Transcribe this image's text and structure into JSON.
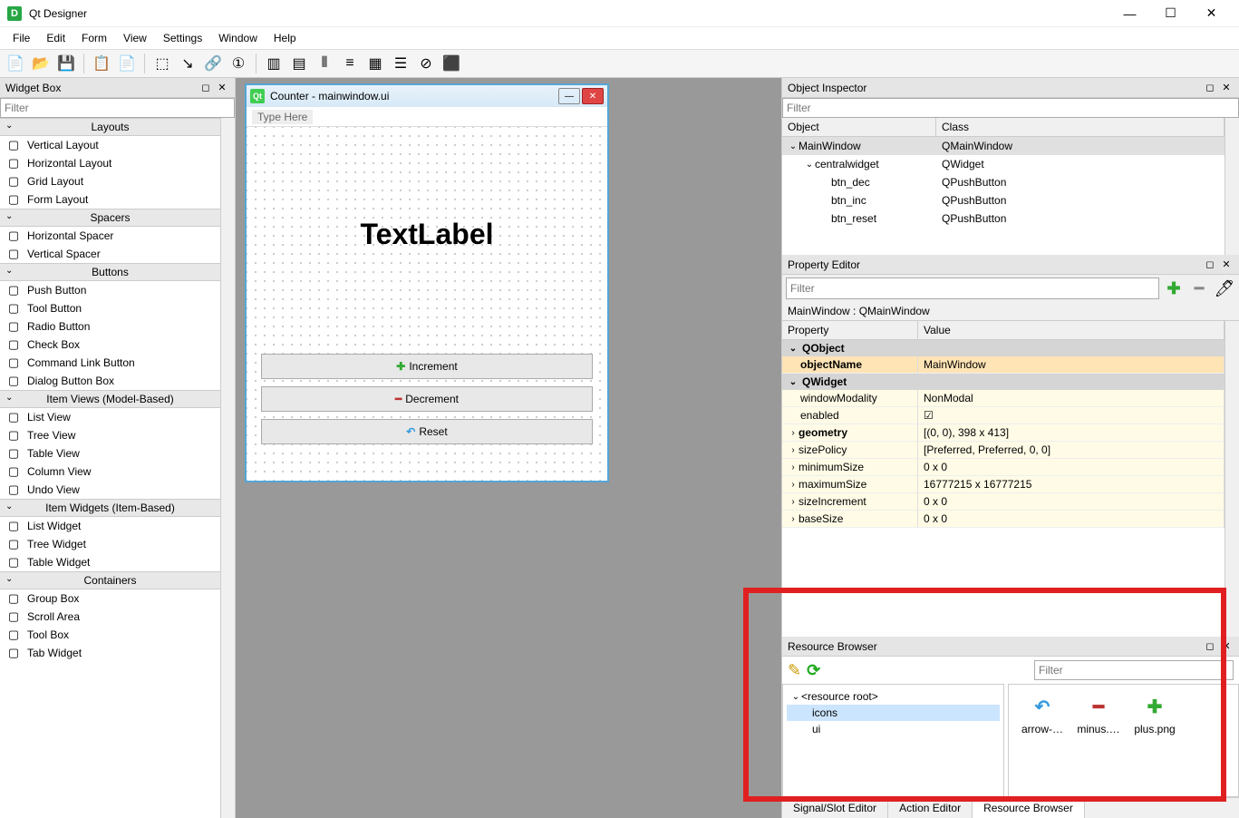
{
  "app": {
    "title": "Qt Designer",
    "icon_letter": "D"
  },
  "win_controls": {
    "min": "—",
    "max": "☐",
    "close": "✕"
  },
  "menubar": [
    "File",
    "Edit",
    "Form",
    "View",
    "Settings",
    "Window",
    "Help"
  ],
  "toolbar_icons": [
    "new",
    "open",
    "save",
    "|",
    "copy",
    "paste",
    "|",
    "layout-select",
    "signal-slot",
    "buddy",
    "tab-order",
    "|",
    "h-layout",
    "v-layout",
    "h-split",
    "v-split",
    "grid",
    "form-layout",
    "break",
    "adjust"
  ],
  "widget_box": {
    "title": "Widget Box",
    "filter_placeholder": "Filter",
    "categories": [
      {
        "name": "Layouts",
        "items": [
          "Vertical Layout",
          "Horizontal Layout",
          "Grid Layout",
          "Form Layout"
        ]
      },
      {
        "name": "Spacers",
        "items": [
          "Horizontal Spacer",
          "Vertical Spacer"
        ]
      },
      {
        "name": "Buttons",
        "items": [
          "Push Button",
          "Tool Button",
          "Radio Button",
          "Check Box",
          "Command Link Button",
          "Dialog Button Box"
        ]
      },
      {
        "name": "Item Views (Model-Based)",
        "items": [
          "List View",
          "Tree View",
          "Table View",
          "Column View",
          "Undo View"
        ]
      },
      {
        "name": "Item Widgets (Item-Based)",
        "items": [
          "List Widget",
          "Tree Widget",
          "Table Widget"
        ]
      },
      {
        "name": "Containers",
        "items": [
          "Group Box",
          "Scroll Area",
          "Tool Box",
          "Tab Widget"
        ]
      }
    ]
  },
  "form": {
    "title": "Counter - mainwindow.ui",
    "type_here": "Type Here",
    "text_label": "TextLabel",
    "buttons": [
      {
        "icon": "plus-icon",
        "glyph": "✚",
        "color": "#3a3",
        "label": "Increment"
      },
      {
        "icon": "minus-icon",
        "glyph": "━",
        "color": "#b33",
        "label": "Decrement"
      },
      {
        "icon": "undo-icon",
        "glyph": "↶",
        "color": "#3399dd",
        "label": "Reset"
      }
    ]
  },
  "object_inspector": {
    "title": "Object Inspector",
    "filter_placeholder": "Filter",
    "cols": [
      "Object",
      "Class"
    ],
    "rows": [
      {
        "indent": 0,
        "expand": "⌄",
        "obj": "MainWindow",
        "cls": "QMainWindow",
        "sel": true
      },
      {
        "indent": 1,
        "expand": "⌄",
        "obj": "centralwidget",
        "cls": "QWidget"
      },
      {
        "indent": 2,
        "expand": "",
        "obj": "btn_dec",
        "cls": "QPushButton"
      },
      {
        "indent": 2,
        "expand": "",
        "obj": "btn_inc",
        "cls": "QPushButton"
      },
      {
        "indent": 2,
        "expand": "",
        "obj": "btn_reset",
        "cls": "QPushButton"
      }
    ]
  },
  "property_editor": {
    "title": "Property Editor",
    "filter_placeholder": "Filter",
    "context": "MainWindow : QMainWindow",
    "cols": [
      "Property",
      "Value"
    ],
    "groups": [
      {
        "name": "QObject",
        "rows": [
          {
            "prop": "objectName",
            "val": "MainWindow",
            "bold": true,
            "style": "name"
          }
        ]
      },
      {
        "name": "QWidget",
        "rows": [
          {
            "prop": "windowModality",
            "val": "NonModal"
          },
          {
            "prop": "enabled",
            "val": "☑"
          },
          {
            "prop": "geometry",
            "val": "[(0, 0), 398 x 413]",
            "bold": true,
            "exp": true
          },
          {
            "prop": "sizePolicy",
            "val": "[Preferred, Preferred, 0, 0]",
            "exp": true
          },
          {
            "prop": "minimumSize",
            "val": "0 x 0",
            "exp": true
          },
          {
            "prop": "maximumSize",
            "val": "16777215 x 16777215",
            "exp": true
          },
          {
            "prop": "sizeIncrement",
            "val": "0 x 0",
            "exp": true
          },
          {
            "prop": "baseSize",
            "val": "0 x 0",
            "exp": true
          }
        ]
      }
    ]
  },
  "resource_browser": {
    "title": "Resource Browser",
    "filter_placeholder": "Filter",
    "tree": [
      {
        "indent": 0,
        "expand": "⌄",
        "label": "<resource root>"
      },
      {
        "indent": 1,
        "label": "icons",
        "sel": true
      },
      {
        "indent": 1,
        "label": "ui"
      }
    ],
    "icons": [
      {
        "glyph": "↶",
        "color": "#3399dd",
        "label": "arrow-…"
      },
      {
        "glyph": "━",
        "color": "#b33",
        "label": "minus.…"
      },
      {
        "glyph": "✚",
        "color": "#3a3",
        "label": "plus.png"
      }
    ],
    "tabs": [
      "Signal/Slot Editor",
      "Action Editor",
      "Resource Browser"
    ],
    "active_tab": 2
  }
}
